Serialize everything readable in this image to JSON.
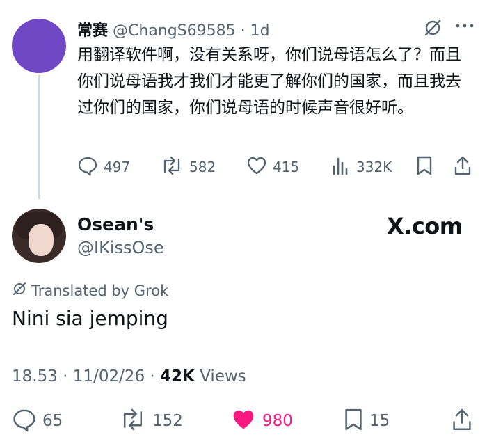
{
  "reply": {
    "display_name": "常赛",
    "handle": "@ChangS69585",
    "dot": " · ",
    "time": "1d",
    "text": "用翻译软件啊，没有关系呀，你们说母语怎么了？而且你们说母语我才我们才能更了解你们的国家，而且我去过你们的国家，你们说母语的时候声音很好听。",
    "actions": {
      "replies": "497",
      "reposts": "582",
      "likes": "415",
      "views": "332K"
    },
    "avatar_color": "#7047c4"
  },
  "post": {
    "display_name": "Osean's",
    "handle": "@IKissOse",
    "watermark": "X.com",
    "translated_label": "Translated by Grok",
    "text": "Nini sia jemping",
    "timestamp": "18.53",
    "date": "11/02/26",
    "views_count": "42K",
    "views_label": "Views",
    "actions": {
      "replies": "65",
      "reposts": "152",
      "likes": "980",
      "bookmarks": "15"
    }
  },
  "colors": {
    "muted": "#536471",
    "text": "#0f1419",
    "like": "#f91880",
    "thread_line": "#cfd9de"
  },
  "icons": [
    "grok-icon",
    "more-icon",
    "reply-icon",
    "repost-icon",
    "like-icon",
    "views-icon",
    "bookmark-icon",
    "share-icon",
    "heart-filled-icon"
  ]
}
